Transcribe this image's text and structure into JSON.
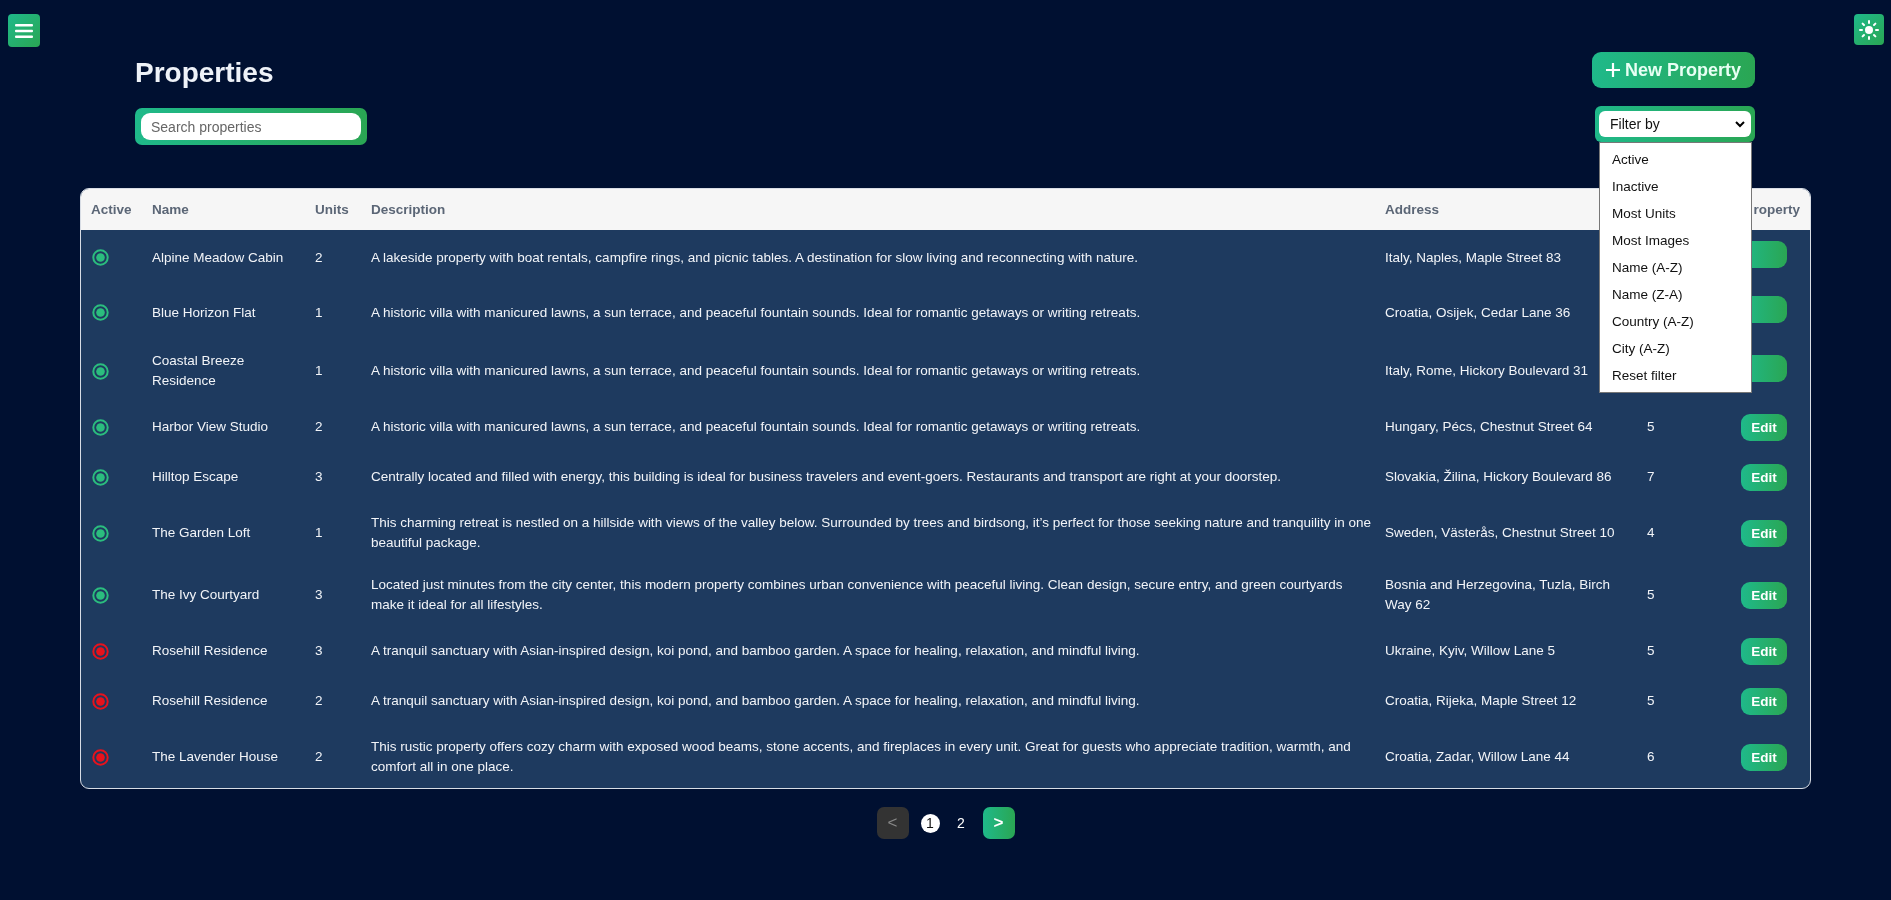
{
  "page": {
    "title": "Properties",
    "new_button": "New Property",
    "search": {
      "placeholder": "Search properties"
    },
    "filter": {
      "value": "Filter by",
      "expanded": true,
      "options": [
        "Active",
        "Inactive",
        "Most Units",
        "Most Images",
        "Name (A-Z)",
        "Name (Z-A)",
        "Country (A-Z)",
        "City (A-Z)",
        "Reset filter"
      ]
    }
  },
  "table": {
    "columns": [
      "Active",
      "Name",
      "Units",
      "Description",
      "Address",
      "",
      "roperty"
    ],
    "rows": [
      {
        "active": true,
        "name": "Alpine Meadow Cabin",
        "units": "2",
        "description": "A lakeside property with boat rentals, campfire rings, and picnic tables. A destination for slow living and reconnecting with nature.",
        "address": "Italy, Naples, Maple Street 83"
      },
      {
        "active": true,
        "name": "Blue Horizon Flat",
        "units": "1",
        "description": "A historic villa with manicured lawns, a sun terrace, and peaceful fountain sounds. Ideal for romantic getaways or writing retreats.",
        "address": "Croatia, Osijek, Cedar Lane 36"
      },
      {
        "active": true,
        "name": "Coastal Breeze Residence",
        "units": "1",
        "description": "A historic villa with manicured lawns, a sun terrace, and peaceful fountain sounds. Ideal for romantic getaways or writing retreats.",
        "address": "Italy, Rome, Hickory Boulevard 31"
      },
      {
        "active": true,
        "name": "Harbor View Studio",
        "units": "2",
        "description": "A historic villa with manicured lawns, a sun terrace, and peaceful fountain sounds. Ideal for romantic getaways or writing retreats.",
        "address": "Hungary, Pécs, Chestnut Street 64",
        "images": "5",
        "edit": "Edit"
      },
      {
        "active": true,
        "name": "Hilltop Escape",
        "units": "3",
        "description": "Centrally located and filled with energy, this building is ideal for business travelers and event-goers. Restaurants and transport are right at your doorstep.",
        "address": "Slovakia, Žilina, Hickory Boulevard 86",
        "images": "7",
        "edit": "Edit"
      },
      {
        "active": true,
        "name": "The Garden Loft",
        "units": "1",
        "description": "This charming retreat is nestled on a hillside with views of the valley below. Surrounded by trees and birdsong, it’s perfect for those seeking nature and tranquility in one beautiful package.",
        "address": "Sweden, Västerås, Chestnut Street 10",
        "images": "4",
        "edit": "Edit"
      },
      {
        "active": true,
        "name": "The Ivy Courtyard",
        "units": "3",
        "description": "Located just minutes from the city center, this modern property combines urban convenience with peaceful living. Clean design, secure entry, and green courtyards make it ideal for all lifestyles.",
        "address": "Bosnia and Herzegovina, Tuzla, Birch Way 62",
        "images": "5",
        "edit": "Edit"
      },
      {
        "active": false,
        "name": "Rosehill Residence",
        "units": "3",
        "description": "A tranquil sanctuary with Asian-inspired design, koi pond, and bamboo garden. A space for healing, relaxation, and mindful living.",
        "address": "Ukraine, Kyiv, Willow Lane 5",
        "images": "5",
        "edit": "Edit"
      },
      {
        "active": false,
        "name": "Rosehill Residence",
        "units": "2",
        "description": "A tranquil sanctuary with Asian-inspired design, koi pond, and bamboo garden. A space for healing, relaxation, and mindful living.",
        "address": "Croatia, Rijeka, Maple Street 12",
        "images": "5",
        "edit": "Edit"
      },
      {
        "active": false,
        "name": "The Lavender House",
        "units": "2",
        "description": "This rustic property offers cozy charm with exposed wood beams, stone accents, and fireplaces in every unit. Great for guests who appreciate tradition, warmth, and comfort all in one place.",
        "address": "Croatia, Zadar, Willow Lane 44",
        "images": "6",
        "edit": "Edit"
      }
    ]
  },
  "pagination": {
    "prev": {
      "label": "<",
      "disabled": true
    },
    "pages": [
      {
        "label": "1",
        "selected": true
      },
      {
        "label": "2",
        "selected": false
      }
    ],
    "next": {
      "label": ">",
      "disabled": false
    }
  }
}
